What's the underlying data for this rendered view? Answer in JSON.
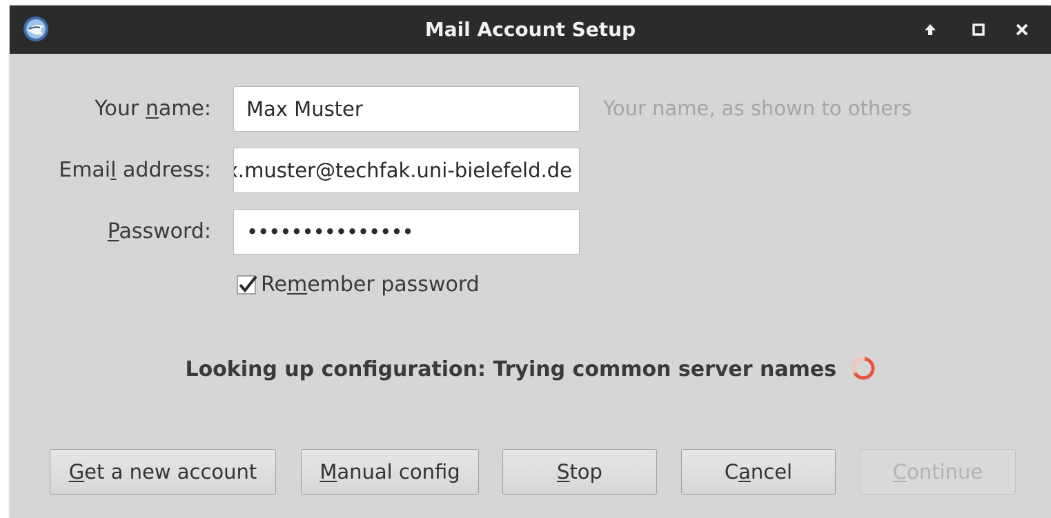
{
  "window": {
    "title": "Mail Account Setup",
    "app_icon": "thunderbird-icon"
  },
  "form": {
    "name": {
      "label_pre": "Your ",
      "label_key": "n",
      "label_post": "ame:",
      "value": "Max Muster",
      "hint": "Your name, as shown to others"
    },
    "email": {
      "label_pre": "Emai",
      "label_key": "l",
      "label_post": " address:",
      "value": "max.muster@techfak.uni-bielefeld.de"
    },
    "password": {
      "label_pre": "",
      "label_key": "P",
      "label_post": "assword:",
      "value": "•••••••••••••••"
    },
    "remember": {
      "label_pre": "Re",
      "label_key": "m",
      "label_post": "ember password",
      "checked": true
    }
  },
  "status": {
    "text": "Looking up configuration: Trying common server names"
  },
  "buttons": {
    "new_account": {
      "pre": "",
      "key": "G",
      "post": "et a new account"
    },
    "manual": {
      "pre": "",
      "key": "M",
      "post": "anual config"
    },
    "stop": {
      "pre": "",
      "key": "S",
      "post": "top"
    },
    "cancel": {
      "pre": "C",
      "key": "a",
      "post": "ncel"
    },
    "continue": {
      "pre": "",
      "key": "C",
      "post": "ontinue",
      "disabled": true
    }
  },
  "colors": {
    "titlebar": "#2b2b2b",
    "dialog_bg": "#d6d6d6",
    "spinner": "#e8553c"
  }
}
